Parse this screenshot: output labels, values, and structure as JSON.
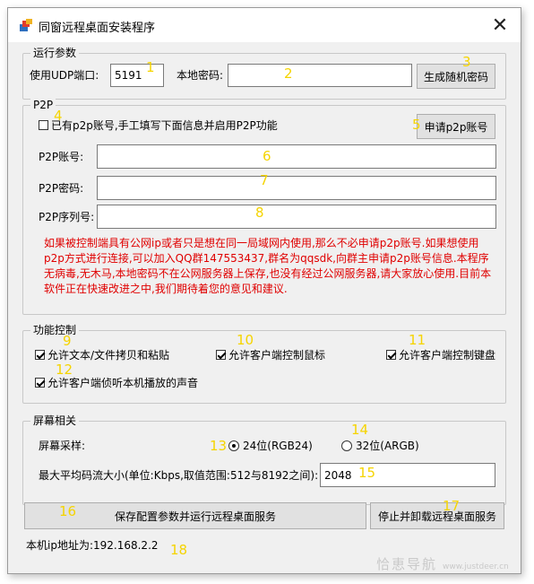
{
  "window": {
    "title": "同窗远程桌面安装程序",
    "close_glyph": "✕"
  },
  "run_params": {
    "legend": "运行参数",
    "udp_label": "使用UDP端口:",
    "udp_value": "5191",
    "local_pwd_label": "本地密码:",
    "local_pwd_value": "",
    "gen_button": "生成随机密码"
  },
  "p2p": {
    "legend": "P2P",
    "has_account_checkbox": "已有p2p账号,手工填写下面信息并启用P2P功能",
    "has_account_checked": false,
    "apply_button": "申请p2p账号",
    "account_label": "P2P账号:",
    "account_value": "",
    "password_label": "P2P密码:",
    "password_value": "",
    "serial_label": "P2P序列号:",
    "serial_value": "",
    "note": "如果被控制端具有公网ip或者只是想在同一局域网内使用,那么不必申请p2p账号.如果想使用p2p方式进行连接,可以加入QQ群147553437,群名为qqsdk,向群主申请p2p账号信息.本程序无病毒,无木马,本地密码不在公网服务器上保存,也没有经过公网服务器,请大家放心使用.目前本软件正在快速改进之中,我们期待着您的意见和建议."
  },
  "control": {
    "legend": "功能控制",
    "items": [
      {
        "label": "允许文本/文件拷贝和粘贴",
        "checked": true
      },
      {
        "label": "允许客户端控制鼠标",
        "checked": true
      },
      {
        "label": "允许客户端控制键盘",
        "checked": true
      },
      {
        "label": "允许客户端侦听本机播放的声音",
        "checked": true
      }
    ]
  },
  "screen": {
    "legend": "屏幕相关",
    "sampling_label": "屏幕采样:",
    "option_24": "24位(RGB24)",
    "option_32": "32位(ARGB)",
    "selected": "24",
    "bitrate_label": "最大平均码流大小(单位:Kbps,取值范围:512与8192之间):",
    "bitrate_value": "2048"
  },
  "actions": {
    "save_run": "保存配置参数并运行远程桌面服务",
    "stop_uninstall": "停止并卸载远程桌面服务"
  },
  "status": {
    "ip_text": "本机ip地址为:192.168.2.2"
  },
  "markers": [
    "1",
    "2",
    "3",
    "4",
    "5",
    "6",
    "7",
    "8",
    "9",
    "10",
    "11",
    "12",
    "13",
    "14",
    "15",
    "16",
    "17",
    "18"
  ],
  "watermark": {
    "text": "恰恵导航",
    "url": "www.justdeer.cn"
  },
  "colors": {
    "note_red": "#e00000",
    "marker_yellow": "#f5d400",
    "window_bg": "#f0f0f0"
  }
}
